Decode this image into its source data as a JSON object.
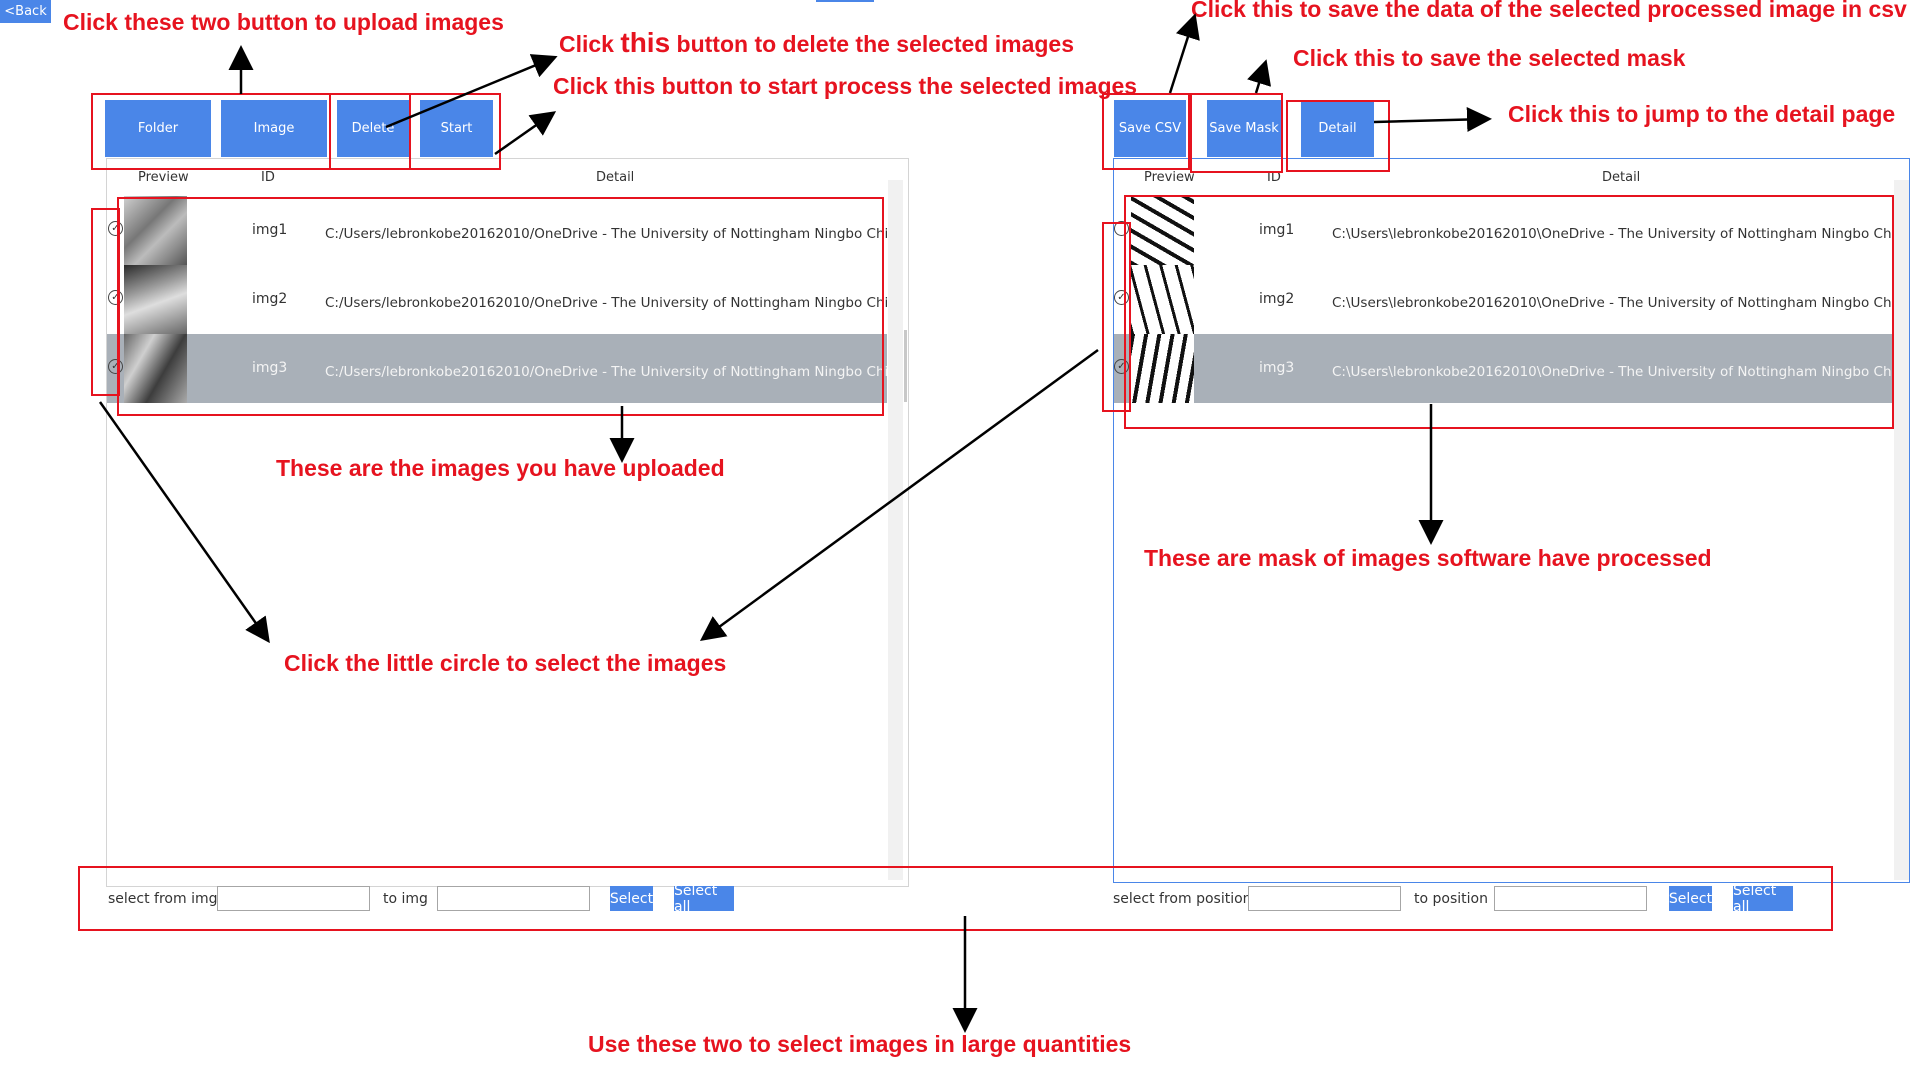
{
  "nav": {
    "back_label": "<Back"
  },
  "left_toolbar": {
    "folder_label": "Folder",
    "image_label": "Image",
    "delete_label": "Delete",
    "start_label": "Start"
  },
  "right_toolbar": {
    "save_csv_label": "Save CSV",
    "save_mask_label": "Save Mask",
    "detail_label": "Detail"
  },
  "left_table": {
    "headers": {
      "preview": "Preview",
      "id": "ID",
      "detail": "Detail"
    },
    "rows": [
      {
        "id": "img1",
        "detail": "C:/Users/lebronkobe20162010/OneDrive - The University of Nottingham Ningbo China/大三",
        "selected": false
      },
      {
        "id": "img2",
        "detail": "C:/Users/lebronkobe20162010/OneDrive - The University of Nottingham Ningbo China/大三",
        "selected": false
      },
      {
        "id": "img3",
        "detail": "C:/Users/lebronkobe20162010/OneDrive - The University of Nottingham Ningbo China/大三",
        "selected": true
      }
    ]
  },
  "right_table": {
    "headers": {
      "preview": "Preview",
      "id": "ID",
      "detail": "Detail"
    },
    "rows": [
      {
        "id": "img1",
        "detail": "C:\\Users\\lebronkobe20162010\\OneDrive - The University of Nottingham Ningbo China\\大三",
        "selected": false
      },
      {
        "id": "img2",
        "detail": "C:\\Users\\lebronkobe20162010\\OneDrive - The University of Nottingham Ningbo China\\大三",
        "selected": false
      },
      {
        "id": "img3",
        "detail": "C:\\Users\\lebronkobe20162010\\OneDrive - The University of Nottingham Ningbo China\\大三",
        "selected": true
      }
    ]
  },
  "left_select": {
    "from_label": "select from img",
    "to_label": "to img",
    "from_value": "",
    "to_value": "",
    "select_label": "Select",
    "select_all_label": "Select all"
  },
  "right_select": {
    "from_label": "select from position",
    "to_label": "to position",
    "from_value": "",
    "to_value": "",
    "select_label": "Select",
    "select_all_label": "Select all"
  },
  "annotations": {
    "upload": "Click these two button to upload images",
    "delete_prefix": "Click ",
    "delete_this": "this",
    "delete_suffix": " button to delete the selected images",
    "start": "Click this button to start process the selected images",
    "uploaded": "These are the images you have uploaded",
    "circle": "Click the little circle to select the images",
    "save_csv": "Click this to save the data of the selected processed image in csv",
    "save_mask": "Click this to save the selected mask",
    "detail": "Click this to jump to the detail page",
    "masks": "These are mask of images software have processed",
    "bulk": "Use these two to select images in large quantities"
  },
  "colors": {
    "accent": "#4a86e8",
    "annotation": "#e6131f",
    "selected_row": "#a9b0b8"
  }
}
